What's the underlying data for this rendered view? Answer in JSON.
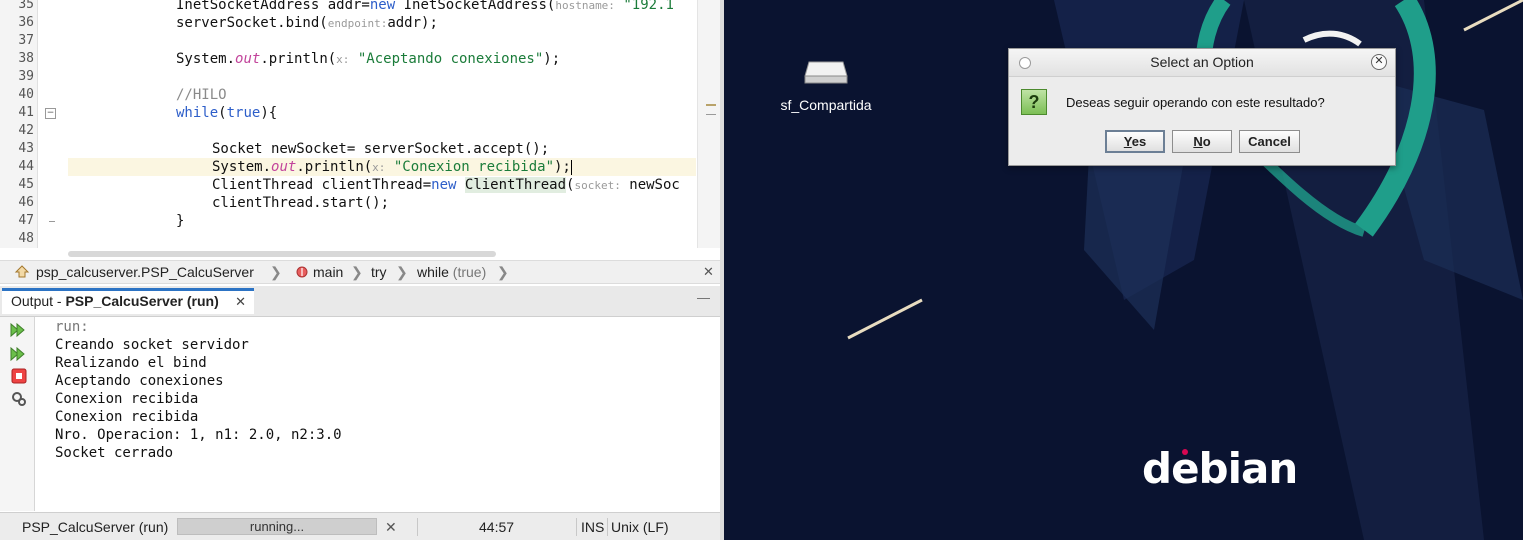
{
  "editor": {
    "lines": [
      {
        "n": "35"
      },
      {
        "n": "36"
      },
      {
        "n": "37"
      },
      {
        "n": "38"
      },
      {
        "n": "39"
      },
      {
        "n": "40"
      },
      {
        "n": "41"
      },
      {
        "n": "42"
      },
      {
        "n": "43"
      },
      {
        "n": "44"
      },
      {
        "n": "45"
      },
      {
        "n": "46"
      },
      {
        "n": "47"
      },
      {
        "n": "48"
      }
    ],
    "code": {
      "l35_type": "InetSocketAddress addr=",
      "l35_kw": "new",
      "l35_call": " InetSocketAddress(",
      "l35_hint": "hostname:",
      "l35_str": " \"192.1",
      "l36_a": "serverSocket.bind(",
      "l36_hint": "endpoint:",
      "l36_b": "addr);",
      "l38_a": "System.",
      "l38_out": "out",
      "l38_b": ".println(",
      "l38_hint": "x:",
      "l38_str": " \"Aceptando conexiones\"",
      "l38_c": ");",
      "l40_comment": "//HILO",
      "l41_kw": "while",
      "l41_a": "(",
      "l41_true": "true",
      "l41_b": "){",
      "l43": "Socket newSocket= serverSocket.accept();",
      "l44_a": "System.",
      "l44_out": "out",
      "l44_b": ".println(",
      "l44_hint": "x:",
      "l44_str": " \"Conexion recibida\"",
      "l44_c": ");",
      "l45_a": "ClientThread clientThread=",
      "l45_kw": "new",
      "l45_cls": "ClientThread",
      "l45_b": "(",
      "l45_hint": "socket:",
      "l45_c": " newSoc",
      "l46": "clientThread.start();",
      "l47": "}"
    }
  },
  "breadcrumb": {
    "class_path": "psp_calcuserver.PSP_CalcuServer",
    "method": "main",
    "try": "try",
    "while": "while",
    "while_cond": "(true)",
    "close": "✕"
  },
  "output": {
    "tab_prefix": "Output - ",
    "tab_name": "PSP_CalcuServer (run)",
    "tab_close": "✕",
    "minimize": "—",
    "lines": [
      "run:",
      "Creando socket servidor",
      "Realizando el bind",
      "Aceptando conexiones",
      "Conexion recibida",
      "Conexion recibida",
      "Nro. Operacion: 1, n1: 2.0, n2:3.0",
      "Socket cerrado"
    ]
  },
  "status": {
    "task": "PSP_CalcuServer (run)",
    "progress_text": "running...",
    "progress_fraction": 1.0,
    "cancel": "✕",
    "position": "44:57",
    "mode": "INS",
    "line_endings": "Unix (LF)"
  },
  "desktop": {
    "drive_label": "sf_Compartida",
    "logo_text": "debian",
    "colors": {
      "background": "#0a1330",
      "accent": "#1f9e8a",
      "logo_dot": "#d70751"
    }
  },
  "dialog": {
    "title": "Select an Option",
    "close": "✕",
    "message": "Deseas seguir operando con este resultado?",
    "icon": "?",
    "yes_mnemonic": "Y",
    "yes_rest": "es",
    "no_mnemonic": "N",
    "no_rest": "o",
    "cancel": "Cancel"
  }
}
